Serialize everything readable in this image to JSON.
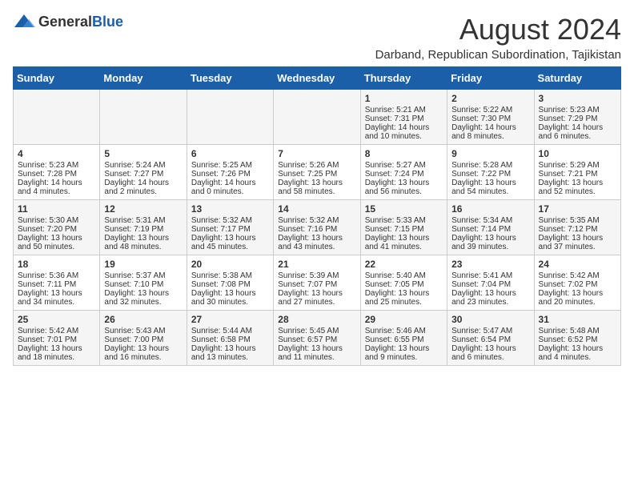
{
  "header": {
    "logo_general": "General",
    "logo_blue": "Blue",
    "month_year": "August 2024",
    "location": "Darband, Republican Subordination, Tajikistan"
  },
  "weekdays": [
    "Sunday",
    "Monday",
    "Tuesday",
    "Wednesday",
    "Thursday",
    "Friday",
    "Saturday"
  ],
  "weeks": [
    [
      {
        "day": "",
        "lines": []
      },
      {
        "day": "",
        "lines": []
      },
      {
        "day": "",
        "lines": []
      },
      {
        "day": "",
        "lines": []
      },
      {
        "day": "1",
        "lines": [
          "Sunrise: 5:21 AM",
          "Sunset: 7:31 PM",
          "Daylight: 14 hours",
          "and 10 minutes."
        ]
      },
      {
        "day": "2",
        "lines": [
          "Sunrise: 5:22 AM",
          "Sunset: 7:30 PM",
          "Daylight: 14 hours",
          "and 8 minutes."
        ]
      },
      {
        "day": "3",
        "lines": [
          "Sunrise: 5:23 AM",
          "Sunset: 7:29 PM",
          "Daylight: 14 hours",
          "and 6 minutes."
        ]
      }
    ],
    [
      {
        "day": "4",
        "lines": [
          "Sunrise: 5:23 AM",
          "Sunset: 7:28 PM",
          "Daylight: 14 hours",
          "and 4 minutes."
        ]
      },
      {
        "day": "5",
        "lines": [
          "Sunrise: 5:24 AM",
          "Sunset: 7:27 PM",
          "Daylight: 14 hours",
          "and 2 minutes."
        ]
      },
      {
        "day": "6",
        "lines": [
          "Sunrise: 5:25 AM",
          "Sunset: 7:26 PM",
          "Daylight: 14 hours",
          "and 0 minutes."
        ]
      },
      {
        "day": "7",
        "lines": [
          "Sunrise: 5:26 AM",
          "Sunset: 7:25 PM",
          "Daylight: 13 hours",
          "and 58 minutes."
        ]
      },
      {
        "day": "8",
        "lines": [
          "Sunrise: 5:27 AM",
          "Sunset: 7:24 PM",
          "Daylight: 13 hours",
          "and 56 minutes."
        ]
      },
      {
        "day": "9",
        "lines": [
          "Sunrise: 5:28 AM",
          "Sunset: 7:22 PM",
          "Daylight: 13 hours",
          "and 54 minutes."
        ]
      },
      {
        "day": "10",
        "lines": [
          "Sunrise: 5:29 AM",
          "Sunset: 7:21 PM",
          "Daylight: 13 hours",
          "and 52 minutes."
        ]
      }
    ],
    [
      {
        "day": "11",
        "lines": [
          "Sunrise: 5:30 AM",
          "Sunset: 7:20 PM",
          "Daylight: 13 hours",
          "and 50 minutes."
        ]
      },
      {
        "day": "12",
        "lines": [
          "Sunrise: 5:31 AM",
          "Sunset: 7:19 PM",
          "Daylight: 13 hours",
          "and 48 minutes."
        ]
      },
      {
        "day": "13",
        "lines": [
          "Sunrise: 5:32 AM",
          "Sunset: 7:17 PM",
          "Daylight: 13 hours",
          "and 45 minutes."
        ]
      },
      {
        "day": "14",
        "lines": [
          "Sunrise: 5:32 AM",
          "Sunset: 7:16 PM",
          "Daylight: 13 hours",
          "and 43 minutes."
        ]
      },
      {
        "day": "15",
        "lines": [
          "Sunrise: 5:33 AM",
          "Sunset: 7:15 PM",
          "Daylight: 13 hours",
          "and 41 minutes."
        ]
      },
      {
        "day": "16",
        "lines": [
          "Sunrise: 5:34 AM",
          "Sunset: 7:14 PM",
          "Daylight: 13 hours",
          "and 39 minutes."
        ]
      },
      {
        "day": "17",
        "lines": [
          "Sunrise: 5:35 AM",
          "Sunset: 7:12 PM",
          "Daylight: 13 hours",
          "and 37 minutes."
        ]
      }
    ],
    [
      {
        "day": "18",
        "lines": [
          "Sunrise: 5:36 AM",
          "Sunset: 7:11 PM",
          "Daylight: 13 hours",
          "and 34 minutes."
        ]
      },
      {
        "day": "19",
        "lines": [
          "Sunrise: 5:37 AM",
          "Sunset: 7:10 PM",
          "Daylight: 13 hours",
          "and 32 minutes."
        ]
      },
      {
        "day": "20",
        "lines": [
          "Sunrise: 5:38 AM",
          "Sunset: 7:08 PM",
          "Daylight: 13 hours",
          "and 30 minutes."
        ]
      },
      {
        "day": "21",
        "lines": [
          "Sunrise: 5:39 AM",
          "Sunset: 7:07 PM",
          "Daylight: 13 hours",
          "and 27 minutes."
        ]
      },
      {
        "day": "22",
        "lines": [
          "Sunrise: 5:40 AM",
          "Sunset: 7:05 PM",
          "Daylight: 13 hours",
          "and 25 minutes."
        ]
      },
      {
        "day": "23",
        "lines": [
          "Sunrise: 5:41 AM",
          "Sunset: 7:04 PM",
          "Daylight: 13 hours",
          "and 23 minutes."
        ]
      },
      {
        "day": "24",
        "lines": [
          "Sunrise: 5:42 AM",
          "Sunset: 7:02 PM",
          "Daylight: 13 hours",
          "and 20 minutes."
        ]
      }
    ],
    [
      {
        "day": "25",
        "lines": [
          "Sunrise: 5:42 AM",
          "Sunset: 7:01 PM",
          "Daylight: 13 hours",
          "and 18 minutes."
        ]
      },
      {
        "day": "26",
        "lines": [
          "Sunrise: 5:43 AM",
          "Sunset: 7:00 PM",
          "Daylight: 13 hours",
          "and 16 minutes."
        ]
      },
      {
        "day": "27",
        "lines": [
          "Sunrise: 5:44 AM",
          "Sunset: 6:58 PM",
          "Daylight: 13 hours",
          "and 13 minutes."
        ]
      },
      {
        "day": "28",
        "lines": [
          "Sunrise: 5:45 AM",
          "Sunset: 6:57 PM",
          "Daylight: 13 hours",
          "and 11 minutes."
        ]
      },
      {
        "day": "29",
        "lines": [
          "Sunrise: 5:46 AM",
          "Sunset: 6:55 PM",
          "Daylight: 13 hours",
          "and 9 minutes."
        ]
      },
      {
        "day": "30",
        "lines": [
          "Sunrise: 5:47 AM",
          "Sunset: 6:54 PM",
          "Daylight: 13 hours",
          "and 6 minutes."
        ]
      },
      {
        "day": "31",
        "lines": [
          "Sunrise: 5:48 AM",
          "Sunset: 6:52 PM",
          "Daylight: 13 hours",
          "and 4 minutes."
        ]
      }
    ]
  ]
}
